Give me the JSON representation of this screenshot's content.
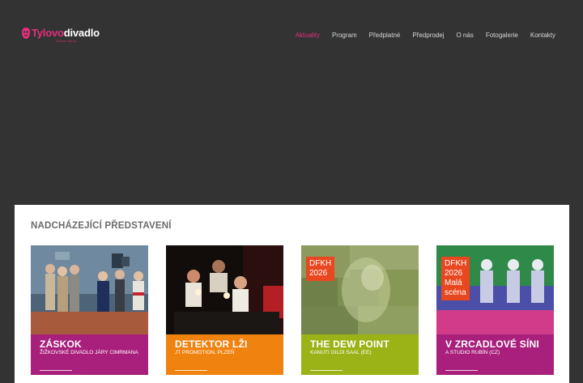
{
  "header": {
    "logo": {
      "part1": "Tylovo",
      "part2": "divadlo",
      "sub": "Kutná Hora"
    },
    "nav": [
      {
        "label": "Aktuality",
        "active": true
      },
      {
        "label": "Program"
      },
      {
        "label": "Předplatné"
      },
      {
        "label": "Předprodej"
      },
      {
        "label": "O nás"
      },
      {
        "label": "Fotogalerie"
      },
      {
        "label": "Kontakty"
      }
    ]
  },
  "main": {
    "section_title": "NADCHÁZEJÍCÍ PŘEDSTAVENÍ",
    "cards": [
      {
        "title": "ZÁSKOK",
        "subtitle": "ŽIŽKOVSKÉ DIVADLO JÁRY CIMRMANA",
        "color": "#a8207c"
      },
      {
        "title": "DETEKTOR LŽI",
        "subtitle": "JT PROMOTION, PLZEŇ",
        "color": "#f0820f"
      },
      {
        "title": "THE DEW POINT",
        "subtitle": "KANUTI GILDI SAAL (EE)",
        "color": "#9bb317",
        "badge": "DFKH\n2026"
      },
      {
        "title": "V ZRCADLOVÉ SÍNI",
        "subtitle": "A STUDIO RUBÍN (CZ)",
        "color": "#a8207c",
        "badge": "DFKH\n2026\nMalá\nscéna"
      }
    ]
  },
  "colors": {
    "accent": "#e3307c",
    "background": "#333333",
    "panel": "#ffffff"
  }
}
